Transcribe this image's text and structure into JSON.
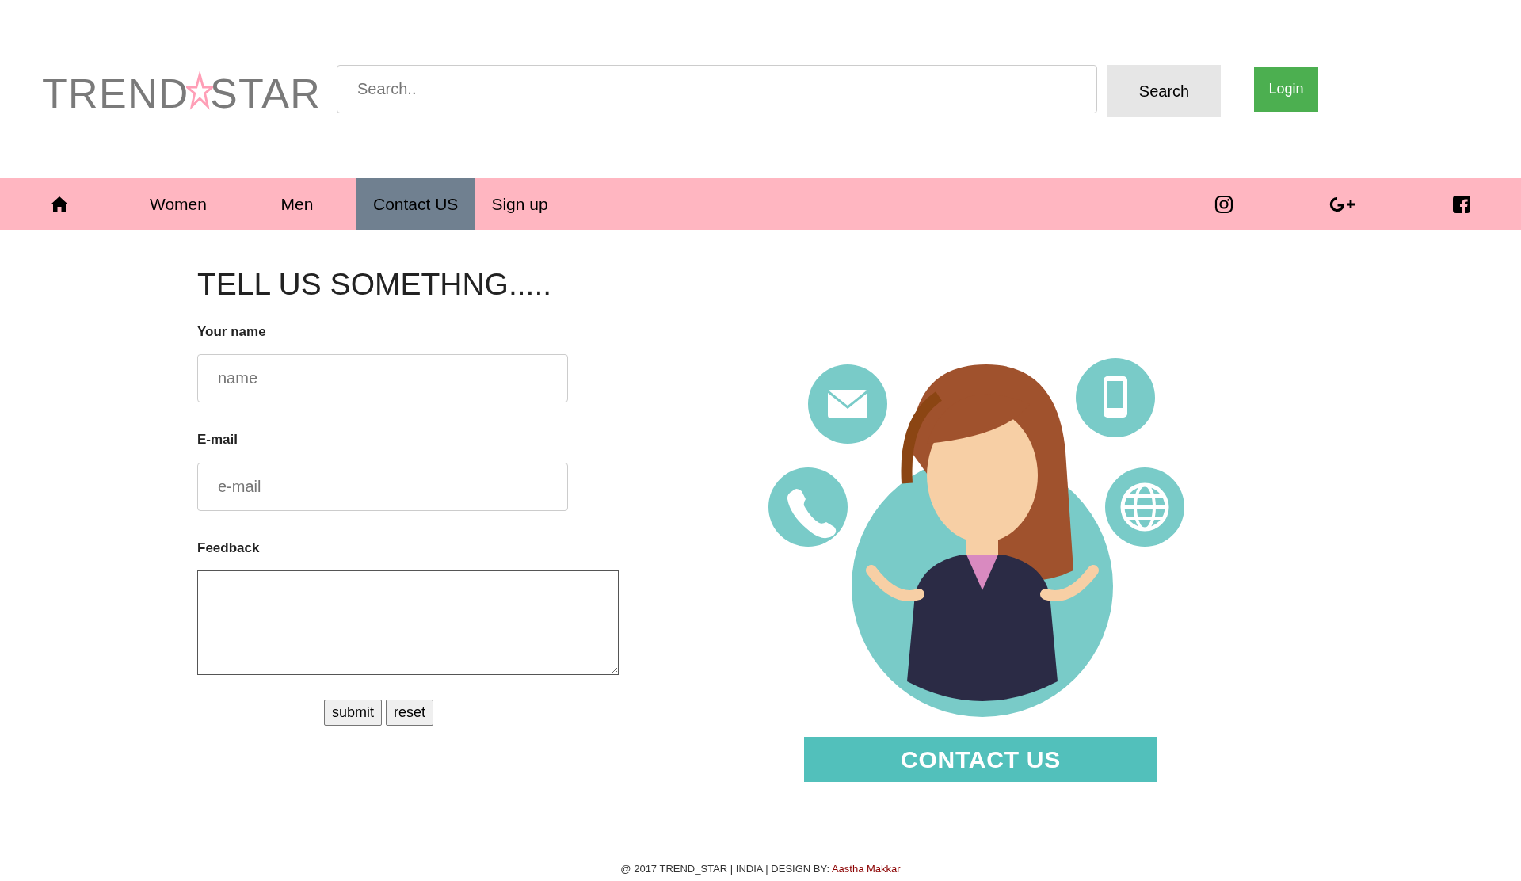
{
  "header": {
    "logo": {
      "left": "TREND",
      "right": "STAR"
    },
    "search": {
      "placeholder": "Search.."
    },
    "search_button": "Search",
    "login_button": "Login"
  },
  "nav": {
    "items": [
      {
        "kind": "home",
        "selected": false
      },
      {
        "kind": "link",
        "label": "Women",
        "selected": false
      },
      {
        "kind": "link",
        "label": "Men",
        "selected": false
      },
      {
        "kind": "link",
        "label": "Contact US",
        "selected": true
      },
      {
        "kind": "link",
        "label": "Sign up",
        "selected": false
      }
    ],
    "social": [
      {
        "kind": "instagram"
      },
      {
        "kind": "google-plus"
      },
      {
        "kind": "facebook"
      }
    ]
  },
  "form": {
    "heading": "TELL US SOMETHNG.....",
    "fields": [
      {
        "kind": "input",
        "label": "Your name",
        "placeholder": "name"
      },
      {
        "kind": "input",
        "label": "E-mail",
        "placeholder": "e-mail"
      },
      {
        "kind": "textarea",
        "label": "Feedback"
      }
    ],
    "buttons": [
      "submit",
      "reset"
    ]
  },
  "illustration": {
    "banner": "CONTACT US"
  },
  "footer": {
    "text": "@ 2017 TREND_STAR | INDIA | DESIGN BY: ",
    "author": "Aastha Makkar"
  }
}
